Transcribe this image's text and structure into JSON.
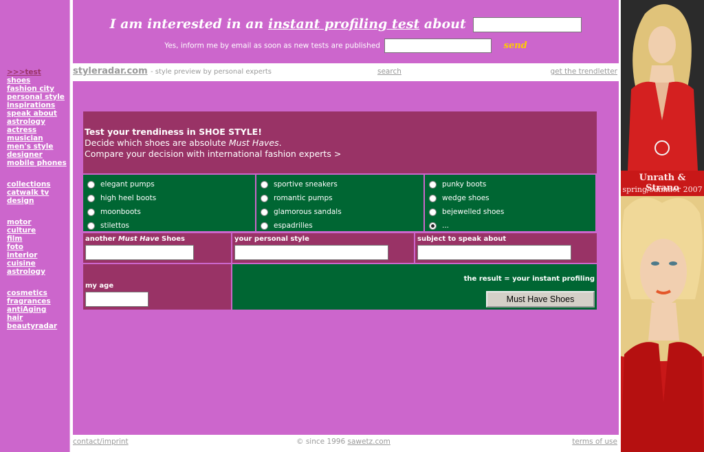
{
  "header": {
    "headline_pre": "I am interested in an",
    "headline_link": "instant profiling test",
    "headline_post": "about",
    "notify_text": "Yes, inform me by email as soon as new tests are published",
    "send_label": "send"
  },
  "navbar": {
    "brand": "styleradar.com",
    "tagline": "- style preview by personal experts",
    "search": "search",
    "trendletter": "get the trendletter"
  },
  "sidebar": {
    "group1": [
      ">>>test",
      "shoes",
      "fashion city",
      "personal style",
      "inspirations",
      "speak about",
      "astrology",
      "actress",
      "musician",
      "men's style",
      "designer",
      "mobile phones"
    ],
    "group2": [
      "collections",
      "catwalk tv",
      "design"
    ],
    "group3": [
      "motor",
      "culture",
      "film",
      "foto",
      "interior",
      "cuisine",
      "astrology"
    ],
    "group4": [
      "cosmetics",
      "fragrances",
      "antiAging",
      "hair",
      "beautyradar"
    ]
  },
  "test": {
    "title": "Test your trendiness in SHOE STYLE!",
    "line2_pre": "Decide which shoes are absolute",
    "line2_em": "Must Haves",
    "line2_post": ".",
    "line3": "Compare your decision with international fashion experts >",
    "options": [
      [
        "elegant pumps",
        "high heel boots",
        "moonboots",
        "stilettos"
      ],
      [
        "sportive sneakers",
        "romantic pumps",
        "glamorous sandals",
        "espadrilles"
      ],
      [
        "punky boots",
        "wedge shoes",
        "bejewelled shoes",
        "..."
      ]
    ],
    "selected_option": "...",
    "field1_pre": "another",
    "field1_em": "Must Have",
    "field1_post": "Shoes",
    "field2": "your personal style",
    "field3": "subject to speak about",
    "age_label": "my age",
    "result_label": "the result = your instant profiling",
    "submit_label": "Must Have Shoes"
  },
  "footer": {
    "contact": "contact/imprint",
    "copy_pre": "© since 1996",
    "copy_link": "sawetz.com",
    "terms": "terms of use"
  },
  "ad": {
    "brand": "Unrath & Strano",
    "season": "spring/summer 2007"
  },
  "colors": {
    "page_bg": "#cc66cc",
    "maroon": "#993366",
    "green": "#006633",
    "send": "#ffcc00"
  }
}
